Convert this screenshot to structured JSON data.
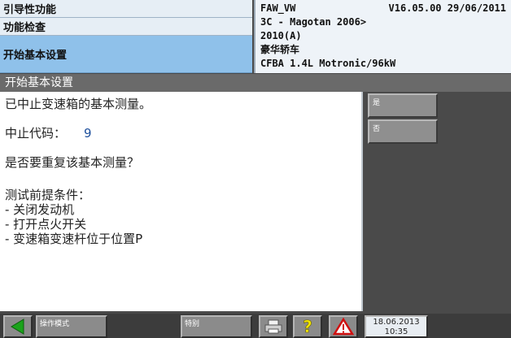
{
  "nav": {
    "items": [
      "引导性功能",
      "功能检查",
      "开始基本设置"
    ]
  },
  "vehicle_info": {
    "brand": "FAW_VW",
    "version": "V16.05.00 29/06/2011",
    "model": "3C - Magotan 2006>",
    "year": "2010(A)",
    "trim": "豪华轿车",
    "engine": "CFBA 1.4L Motronic/96kW"
  },
  "titlebar": {
    "title": "开始基本设置"
  },
  "content": {
    "message": "已中止变速箱的基本测量。",
    "abort_code_label": "中止代码：",
    "abort_code_value": "9",
    "question": "是否要重复该基本测量？",
    "preconditions_title": "测试前提条件：",
    "preconditions": [
      "- 关闭发动机",
      "- 打开点火开关",
      "- 变速箱变速杆位于位置P"
    ]
  },
  "side_buttons": {
    "yes": "是",
    "no": "否"
  },
  "toolbar": {
    "mode_label": "操作模式",
    "special_label": "特别",
    "date": "18.06.2013",
    "time": "10:35"
  },
  "colors": {
    "selected_nav": "#8fc1ea",
    "back_arrow": "#1aa31a",
    "help_icon": "#f2e600",
    "warning_icon": "#d01010"
  },
  "icons": {
    "back": "back-arrow-icon",
    "print": "printer-icon",
    "help": "help-icon",
    "warning": "warning-icon"
  }
}
